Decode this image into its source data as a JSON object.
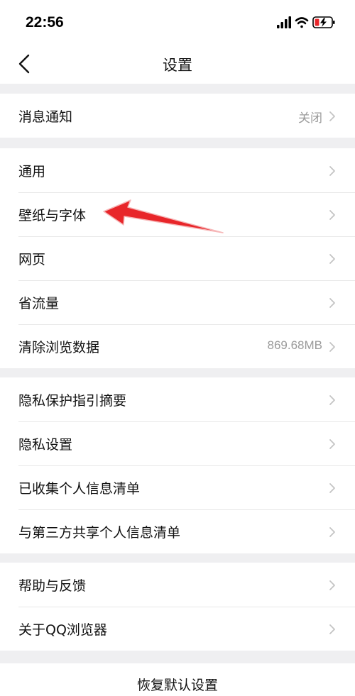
{
  "status_bar": {
    "time": "22:56"
  },
  "nav": {
    "title": "设置"
  },
  "groups": [
    {
      "items": [
        {
          "label": "消息通知",
          "value": "关闭"
        }
      ]
    },
    {
      "items": [
        {
          "label": "通用"
        },
        {
          "label": "壁纸与字体"
        },
        {
          "label": "网页"
        },
        {
          "label": "省流量"
        },
        {
          "label": "清除浏览数据",
          "value": "869.68MB"
        }
      ]
    },
    {
      "items": [
        {
          "label": "隐私保护指引摘要"
        },
        {
          "label": "隐私设置"
        },
        {
          "label": "已收集个人信息清单"
        },
        {
          "label": "与第三方共享个人信息清单"
        }
      ]
    },
    {
      "items": [
        {
          "label": "帮助与反馈"
        },
        {
          "label": "关于QQ浏览器"
        }
      ]
    }
  ],
  "reset": {
    "label": "恢复默认设置"
  },
  "colors": {
    "background": "#efeff1",
    "annotation_arrow": "#e8262a",
    "secondary_text": "#9a9a9a",
    "chevron": "#c4c4c4"
  }
}
